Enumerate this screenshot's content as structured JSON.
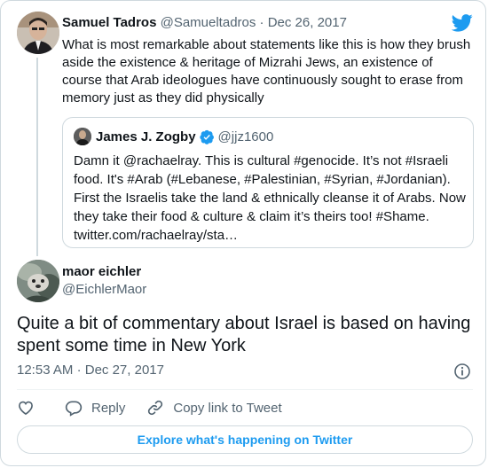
{
  "parent_tweet": {
    "name": "Samuel Tadros",
    "handle": "@Samueltadros",
    "separator": "·",
    "date": "Dec 26, 2017",
    "text": "What is most remarkable about statements like this is how they brush aside the existence & heritage of Mizrahi Jews, an existence of course that Arab ideologues have continuously sought to erase from memory just as they did physically"
  },
  "quoted_tweet": {
    "name": "James J. Zogby",
    "handle": "@jjz1600",
    "text": "Damn it @rachaelray. This is cultural #genocide. It’s not #Israeli food. It's #Arab (#Lebanese, #Palestinian, #Syrian, #Jordanian). First the Israelis take the land & ethnically cleanse it of Arabs. Now they take their food & culture & claim it’s theirs too! #Shame. twitter.com/rachaelray/sta…"
  },
  "main_tweet": {
    "name": "maor eichler",
    "handle": "@EichlerMaor",
    "text": "Quite a bit of commentary about Israel is based on having spent some time in New York",
    "time": "12:53 AM",
    "separator": "·",
    "date": "Dec 27, 2017"
  },
  "actions": {
    "reply_label": "Reply",
    "copy_label": "Copy link to Tweet"
  },
  "explore_label": "Explore what's happening on Twitter",
  "colors": {
    "accent": "#1d9bf0",
    "secondary_text": "#536471",
    "border": "#cfd9de"
  },
  "icons": [
    "twitter-bird-icon",
    "verified-badge-icon",
    "info-icon",
    "heart-icon",
    "reply-icon",
    "link-icon"
  ]
}
